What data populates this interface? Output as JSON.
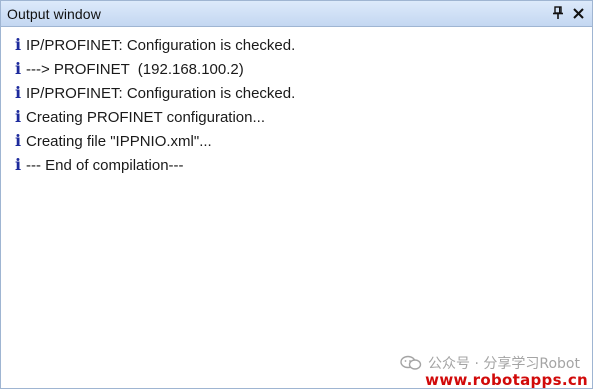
{
  "window": {
    "title": "Output window",
    "pin_icon": "pin-icon",
    "close_icon": "close-icon"
  },
  "log": {
    "entries": [
      {
        "icon": "info-icon",
        "text": "IP/PROFINET: Configuration is checked."
      },
      {
        "icon": "info-icon",
        "text": "---> PROFINET  (192.168.100.2)"
      },
      {
        "icon": "info-icon",
        "text": "IP/PROFINET: Configuration is checked."
      },
      {
        "icon": "info-icon",
        "text": "Creating PROFINET configuration..."
      },
      {
        "icon": "info-icon",
        "text": "Creating file \"IPPNIO.xml\"..."
      },
      {
        "icon": "info-icon",
        "text": "--- End of compilation---"
      }
    ]
  },
  "watermark": {
    "channel": "公众号 · 分享学习Robot",
    "url": "www.robotapps.cn",
    "logo_icon": "wechat-logo-icon"
  },
  "colors": {
    "titlebar": "#c4d7f1",
    "info_icon": "#1d2a9c",
    "watermark_url": "#d10a0a"
  }
}
